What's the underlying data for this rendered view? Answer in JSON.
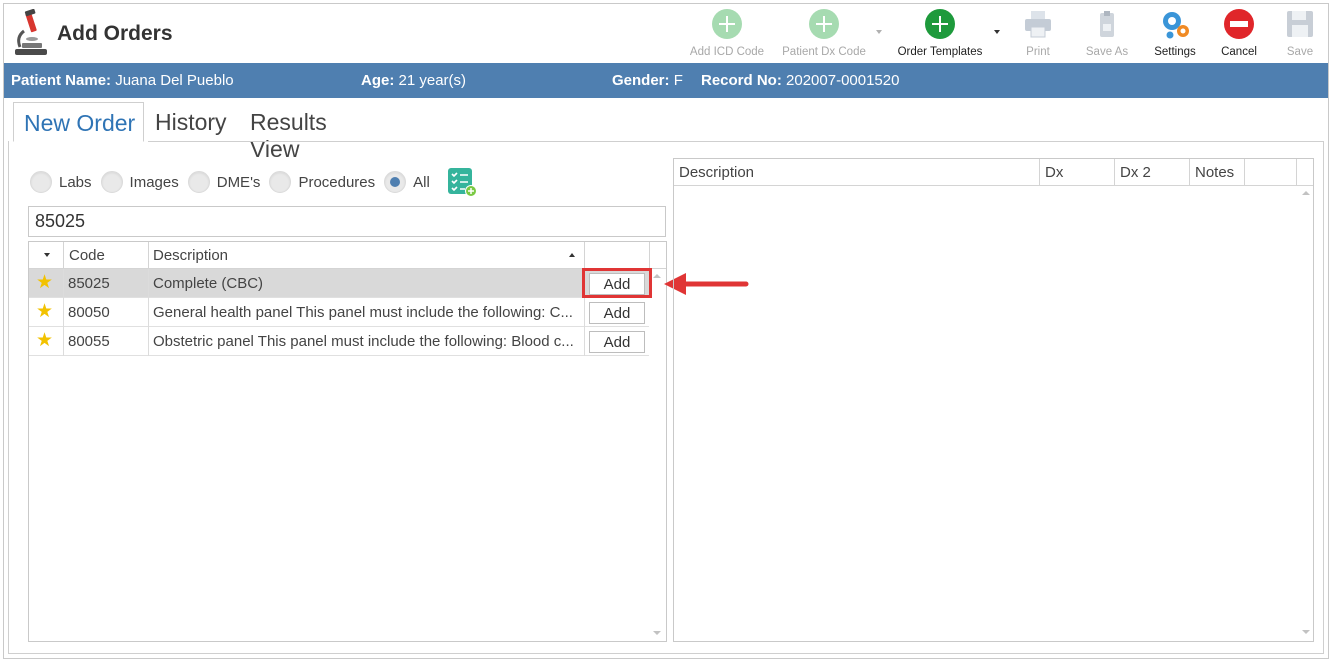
{
  "window": {
    "title": "Add Orders"
  },
  "toolbar": {
    "add_icd_code": "Add ICD Code",
    "patient_dx_code": "Patient Dx Code",
    "order_templates": "Order Templates",
    "print": "Print",
    "save_as": "Save As",
    "settings": "Settings",
    "cancel": "Cancel",
    "save": "Save"
  },
  "patient": {
    "name_label": "Patient Name:",
    "name": "Juana Del Pueblo",
    "age_label": "Age:",
    "age": "21 year(s)",
    "gender_label": "Gender:",
    "gender": "F",
    "record_label": "Record No:",
    "record": "202007-0001520"
  },
  "tabs": [
    "New Order",
    "History",
    "Results View"
  ],
  "filters": {
    "options": [
      "Labs",
      "Images",
      "DME's",
      "Procedures",
      "All"
    ],
    "selected": "All"
  },
  "search": {
    "value": "85025"
  },
  "left_grid": {
    "columns": [
      "Code",
      "Description"
    ],
    "rows": [
      {
        "code": "85025",
        "description": "Complete (CBC)",
        "action": "Add"
      },
      {
        "code": "80050",
        "description": "General health panel This panel must include the following: C...",
        "action": "Add"
      },
      {
        "code": "80055",
        "description": "Obstetric panel This panel must include the following: Blood c...",
        "action": "Add"
      }
    ]
  },
  "right_grid": {
    "columns": [
      "Description",
      "Dx",
      "Dx 2",
      "Notes"
    ]
  },
  "colors": {
    "banner": "#4f7fb0",
    "tab_active": "#2f74b5",
    "highlight": "#e03535",
    "star": "#f2c200"
  }
}
